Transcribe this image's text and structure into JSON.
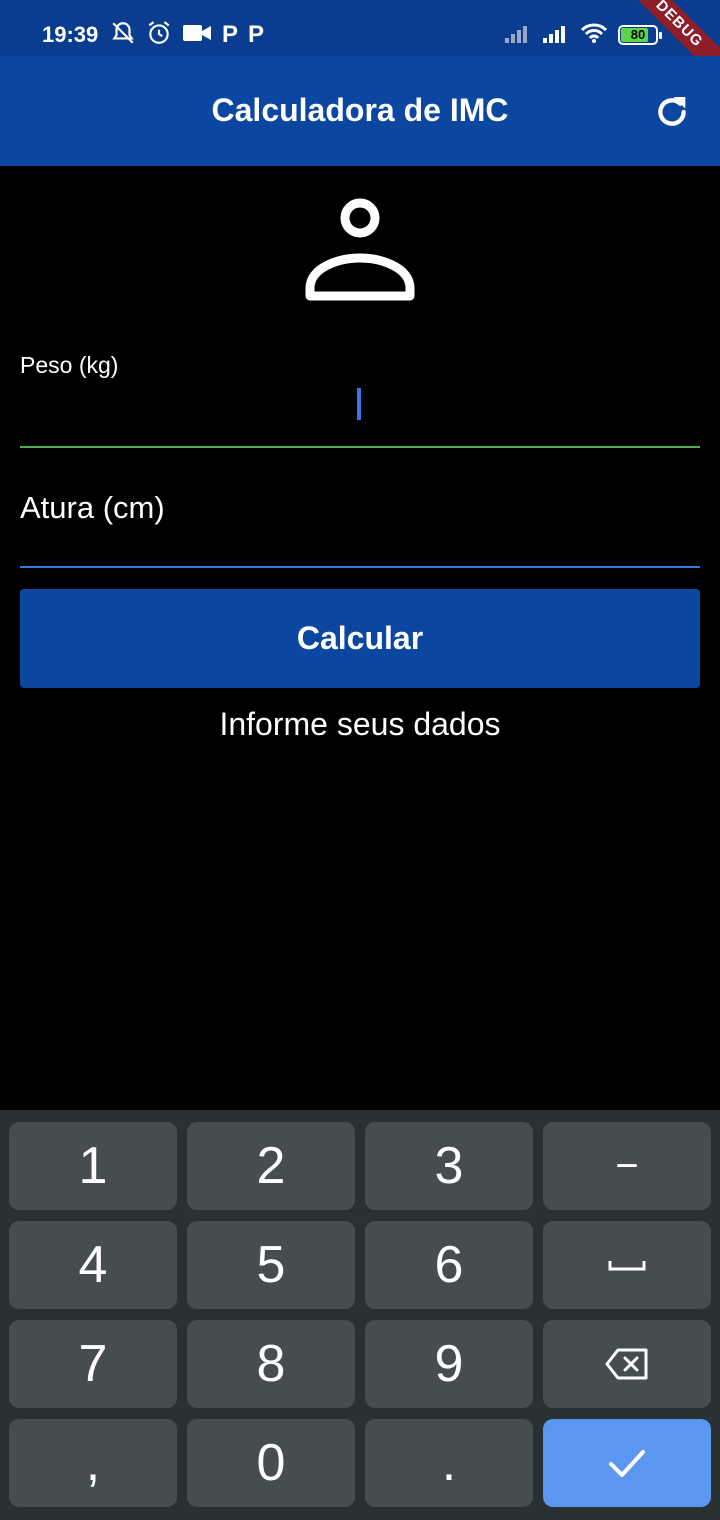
{
  "status_bar": {
    "time": "19:39",
    "left_icons": [
      "mute-icon",
      "alarm-icon",
      "video-icon",
      "parking-icon",
      "parking-icon"
    ],
    "p_labels": [
      "P",
      "P"
    ],
    "right_icons": [
      "signal-weak-icon",
      "signal-icon",
      "wifi-icon",
      "battery-icon"
    ],
    "battery_level": "80",
    "battery_fraction": 0.8
  },
  "debug_banner": "DEBUG",
  "app_bar": {
    "title": "Calculadora de IMC",
    "action_icon": "refresh-icon"
  },
  "main": {
    "icon": "person-outline-icon",
    "weight_field": {
      "label": "Peso (kg)",
      "value": ""
    },
    "height_field": {
      "label": "Atura (cm)",
      "value": ""
    },
    "calculate_button": "Calcular",
    "info_text": "Informe seus dados"
  },
  "keyboard": {
    "keys": [
      [
        "1",
        "2",
        "3",
        "−"
      ],
      [
        "4",
        "5",
        "6",
        "␣"
      ],
      [
        "7",
        "8",
        "9",
        "backspace-icon"
      ],
      [
        ",",
        "0",
        ".",
        "check-icon"
      ]
    ]
  },
  "colors": {
    "status_bar": "#0a3d8f",
    "app_bar": "#0b47a1",
    "button": "#0b47a1",
    "focused_underline": "#4caf50",
    "field_underline": "#3b78e7",
    "keyboard_bg": "#2a3133",
    "key_bg": "#454d4f",
    "confirm_key": "#5b97f0",
    "debug_banner": "#8e1f2a"
  }
}
